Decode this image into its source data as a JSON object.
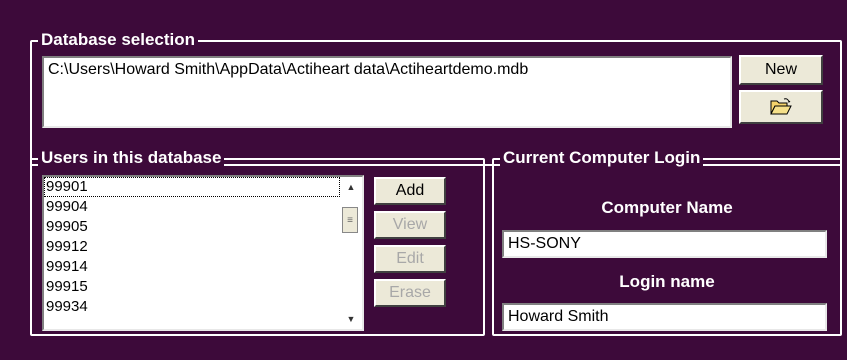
{
  "database": {
    "legend": "Database selection",
    "path": "C:\\Users\\Howard Smith\\AppData\\Actiheart data\\Actiheartdemo.mdb",
    "new_label": "New",
    "open_icon": "folder-open-icon"
  },
  "users": {
    "legend": "Users in this database",
    "items": [
      "99901",
      "99904",
      "99905",
      "99912",
      "99914",
      "99915",
      "99934"
    ],
    "selected_index": 0,
    "buttons": {
      "add": "Add",
      "view": "View",
      "edit": "Edit",
      "erase": "Erase"
    }
  },
  "login": {
    "legend": "Current Computer Login",
    "computer_name_label": "Computer Name",
    "computer_name": "HS-SONY",
    "login_name_label": "Login name",
    "login_name": "Howard Smith"
  },
  "colors": {
    "background": "#3d0a3a",
    "border": "#ffffff",
    "button_face": "#ece9d8"
  }
}
